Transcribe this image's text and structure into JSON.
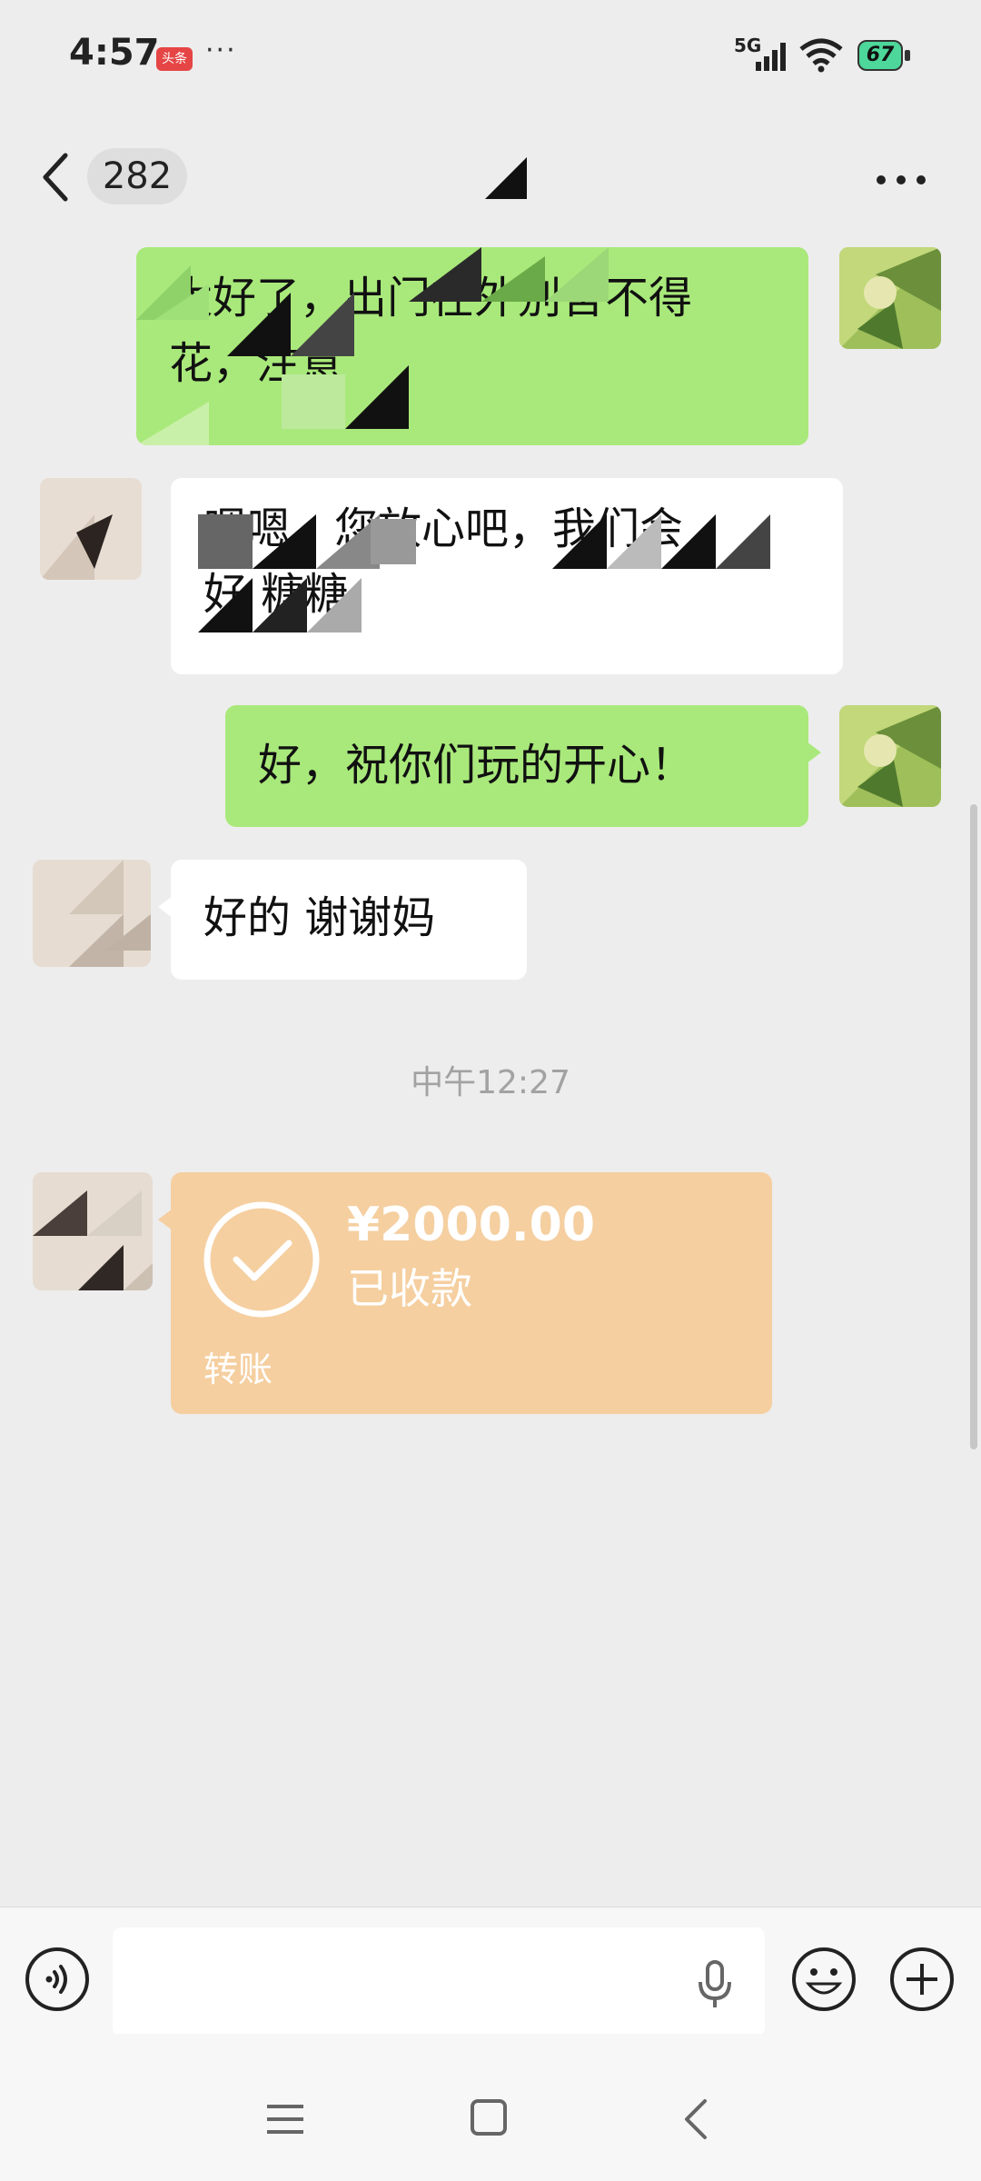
{
  "status_bar": {
    "time": "4:57",
    "notification_badge": "头条",
    "more_dots": "···",
    "network": "5G",
    "battery_level": "67",
    "battery_color": "#4dd79a"
  },
  "header": {
    "unread_count": "282"
  },
  "messages": [
    {
      "side": "right",
      "text_line1": "太好了，出门在外别舍不得",
      "text_line2": "花，注意"
    },
    {
      "side": "left",
      "text_line1": "嗯嗯，您放心吧，我们会",
      "text_line2": "好 糖糖"
    },
    {
      "side": "right",
      "text": "好，祝你们玩的开心！"
    },
    {
      "side": "left",
      "text": "好的  谢谢妈"
    }
  ],
  "timestamp": "中午12:27",
  "transfer": {
    "amount": "¥2000.00",
    "status": "已收款",
    "label": "转账",
    "color": "#f5cfa0"
  },
  "colors": {
    "accent_green": "#a9e97b",
    "background": "#ededed"
  },
  "icons": {
    "back": "chevron-left-icon",
    "more": "more-horizontal-icon",
    "voice": "voice-icon",
    "mic": "microphone-icon",
    "emoji": "emoji-icon",
    "plus": "plus-icon",
    "check": "check-circle-icon",
    "nav_menu": "menu-icon",
    "nav_home": "home-icon",
    "nav_back": "back-icon"
  }
}
